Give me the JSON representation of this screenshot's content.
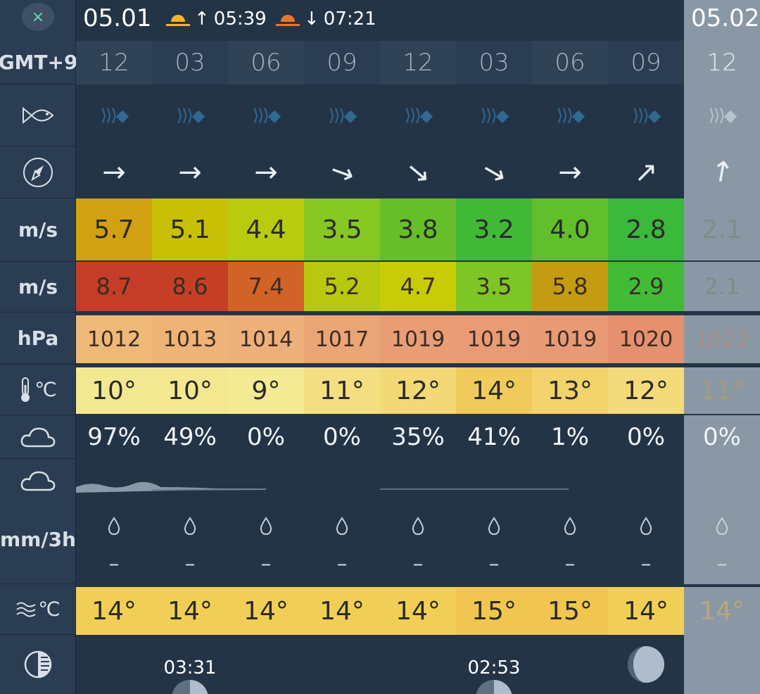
{
  "header": {
    "close_icon": "×",
    "date_left": "05.01",
    "sunrise_arrow": "↑",
    "sunrise": "05:39",
    "sunset_arrow": "↓",
    "sunset": "07:21",
    "date_right": "05.02"
  },
  "sidebar": {
    "timezone": "GMT+9",
    "wind_unit": "m/s",
    "gust_unit": "m/s",
    "pressure_unit": "hPa",
    "temp_unit": "℃",
    "rain_unit": "mm/3h",
    "water_temp_unit": "℃",
    "icons": [
      "close-icon",
      "fish-icon",
      "compass-icon",
      "thermometer-icon",
      "cloud-icon",
      "cloud-rain-icon",
      "waves-icon",
      "moon-phase-icon"
    ]
  },
  "forecast": {
    "hours": [
      "12",
      "03",
      "06",
      "09",
      "12",
      "03",
      "06",
      "09",
      "12"
    ],
    "fish_icon": "⟩⟩⟩◆",
    "wind_dir": [
      "→",
      "→",
      "→",
      "↘",
      "↘",
      "↘",
      "→",
      "↗",
      "↑"
    ],
    "wind_dir_deg": [
      0,
      0,
      0,
      20,
      40,
      30,
      0,
      -45,
      -80
    ],
    "wind": [
      "5.7",
      "5.1",
      "4.4",
      "3.5",
      "3.8",
      "3.2",
      "4.0",
      "2.8",
      "2.1"
    ],
    "wind_colors": [
      "#d2a111",
      "#c8c005",
      "#b9cb0d",
      "#86c721",
      "#66bf28",
      "#3fb936",
      "#60bf2b",
      "#3ab93a",
      "#9cdd90"
    ],
    "gust": [
      "8.7",
      "8.6",
      "7.4",
      "5.2",
      "4.7",
      "3.5",
      "5.8",
      "2.9",
      "2.1"
    ],
    "gust_colors": [
      "#c53d27",
      "#c53f27",
      "#d26327",
      "#b7c80f",
      "#c8cc06",
      "#7ec526",
      "#c39c12",
      "#41bb36",
      "#9cdd90"
    ],
    "pressure": [
      "1012",
      "1013",
      "1014",
      "1017",
      "1019",
      "1019",
      "1019",
      "1020",
      "1022"
    ],
    "pressure_colors": [
      "#eeb877",
      "#eeb377",
      "#edb07a",
      "#eaa576",
      "#e99d75",
      "#e89b75",
      "#e89a76",
      "#e5906f",
      "#e0b9ab"
    ],
    "temp": [
      "10°",
      "10°",
      "9°",
      "11°",
      "12°",
      "14°",
      "13°",
      "12°",
      "11°"
    ],
    "temp_colors": [
      "#f3e892",
      "#f3e890",
      "#f4ea93",
      "#f3df82",
      "#f3d876",
      "#f0cb5c",
      "#f2d26a",
      "#f3da7a",
      "#f6edb8"
    ],
    "cloud": [
      "97%",
      "49%",
      "0%",
      "0%",
      "35%",
      "41%",
      "1%",
      "0%",
      "0%"
    ],
    "rain_icon": "💧",
    "rain": [
      "–",
      "–",
      "–",
      "–",
      "–",
      "–",
      "–",
      "–",
      "–"
    ],
    "water_temp": [
      "14°",
      "14°",
      "14°",
      "14°",
      "14°",
      "15°",
      "15°",
      "14°",
      "14°"
    ],
    "water_temp_colors": [
      "#f1cf57",
      "#f1cf57",
      "#f1cf57",
      "#f1cf57",
      "#f1cf57",
      "#f0c650",
      "#f0c650",
      "#f1cf57",
      "#f3df98"
    ],
    "moon_times": [
      "",
      "03:31",
      "",
      "",
      "",
      "02:53",
      "",
      "",
      ""
    ]
  }
}
